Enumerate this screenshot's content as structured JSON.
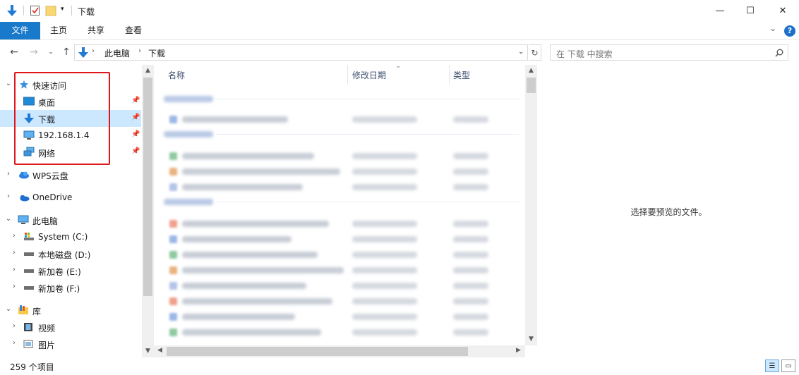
{
  "window": {
    "title": "下载",
    "minimize_glyph": "—",
    "maximize_glyph": "☐",
    "close_glyph": "✕"
  },
  "ribbon": {
    "tabs": [
      {
        "label": "文件",
        "active": true
      },
      {
        "label": "主页"
      },
      {
        "label": "共享"
      },
      {
        "label": "查看"
      }
    ],
    "help_glyph": "?",
    "expand_glyph": "⌄"
  },
  "address": {
    "crumbs": [
      "此电脑",
      "下载"
    ],
    "separator": "›",
    "search_placeholder": "在 下载 中搜索"
  },
  "nav": {
    "items": [
      {
        "label": "快速访问",
        "icon": "quick-access-star-icon",
        "expanded": true
      },
      {
        "label": "桌面",
        "icon": "desktop-icon",
        "pinned": true
      },
      {
        "label": "下载",
        "icon": "download-arrow-icon",
        "pinned": true,
        "selected": true
      },
      {
        "label": "192.168.1.4",
        "icon": "computer-icon",
        "pinned": true
      },
      {
        "label": "网络",
        "icon": "network-icon",
        "pinned": true
      },
      {
        "label": "WPS云盘",
        "icon": "wps-cloud-icon",
        "expanded": false
      },
      {
        "label": "OneDrive",
        "icon": "onedrive-icon",
        "expanded": false
      },
      {
        "label": "此电脑",
        "icon": "this-pc-icon",
        "expanded": true
      },
      {
        "label": "System (C:)",
        "icon": "system-drive-icon",
        "expanded": false
      },
      {
        "label": "本地磁盘 (D:)",
        "icon": "drive-icon",
        "expanded": false
      },
      {
        "label": "新加卷 (E:)",
        "icon": "drive-icon",
        "expanded": false
      },
      {
        "label": "新加卷 (F:)",
        "icon": "drive-icon",
        "expanded": false
      },
      {
        "label": "库",
        "icon": "library-icon",
        "expanded": true
      },
      {
        "label": "视频",
        "icon": "video-library-icon",
        "expanded": false
      },
      {
        "label": "图片",
        "icon": "pictures-library-icon",
        "expanded": false
      }
    ]
  },
  "filelist": {
    "columns": [
      "名称",
      "修改日期",
      "类型"
    ],
    "sort_glyph": "⌄"
  },
  "preview": {
    "empty_text": "选择要预览的文件。"
  },
  "status": {
    "item_count": "259 个项目"
  },
  "colors": {
    "accent": "#1979ca",
    "selection": "#cce8ff",
    "annotation_red": "#e0161b"
  }
}
